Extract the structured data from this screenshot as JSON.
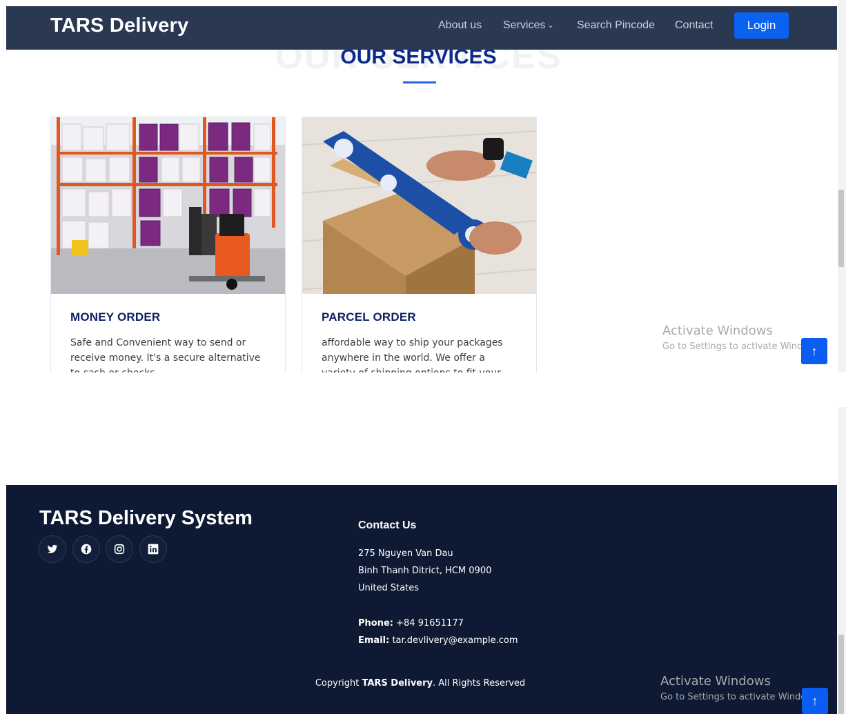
{
  "navbar": {
    "brand": "TARS Delivery",
    "links": [
      "About us",
      "Services",
      "Search Pincode",
      "Contact"
    ],
    "login_label": "Login"
  },
  "services": {
    "watermark": "OUR SERVICES",
    "title": "OUR SERVICES",
    "cards": [
      {
        "title": "MONEY ORDER",
        "description": "Safe and Convenient way to send or receive money. It's a secure alternative to cash or checks."
      },
      {
        "title": "PARCEL ORDER",
        "description": "affordable way to ship your packages anywhere in the world. We offer a variety of shipping options to fit your needs and"
      }
    ]
  },
  "windows_notice": {
    "title": "Activate Windows",
    "subtitle": "Go to Settings to activate Windows."
  },
  "back_to_top": "↑",
  "footer": {
    "brand": "TARS Delivery System",
    "social_icons": [
      "twitter-icon",
      "facebook-icon",
      "instagram-icon",
      "linkedin-icon"
    ],
    "contact_title": "Contact Us",
    "address_line1": "275 Nguyen Van Dau",
    "address_line2": "Binh Thanh Ditrict, HCM 0900",
    "address_line3": "United States",
    "phone_label": "Phone:",
    "phone_value": "+84 91651177",
    "email_label": "Email:",
    "email_value": "tar.devlivery@example.com",
    "copyright_prefix": "Copyright",
    "copyright_brand": "TARS Delivery",
    "copyright_suffix": ". All Rights Reserved"
  },
  "colors": {
    "navbar_bg": "#2a3951",
    "accent_blue": "#0a63f0",
    "title_navy": "#0d2a8a",
    "footer_bg": "#0e1a33"
  }
}
